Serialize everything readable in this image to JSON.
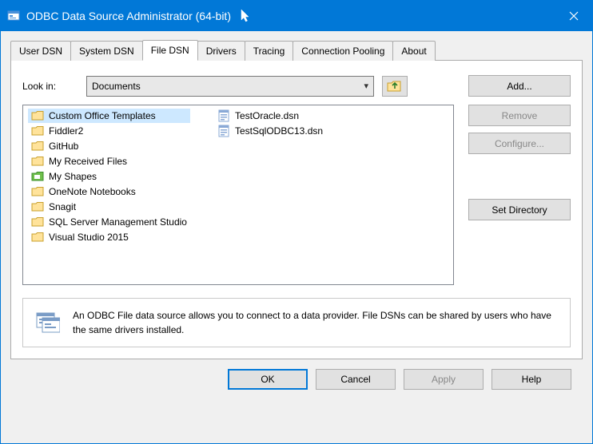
{
  "titlebar": {
    "title": "ODBC Data Source Administrator (64-bit)"
  },
  "tabs": {
    "items": [
      "User DSN",
      "System DSN",
      "File DSN",
      "Drivers",
      "Tracing",
      "Connection Pooling",
      "About"
    ],
    "active_index": 2
  },
  "lookin": {
    "label": "Look in:",
    "value": "Documents"
  },
  "folders": [
    "Custom Office Templates",
    "Fiddler2",
    "GitHub",
    "My Received Files",
    "My Shapes",
    "OneNote Notebooks",
    "Snagit",
    "SQL Server Management Studio",
    "Visual Studio 2015"
  ],
  "files": [
    "TestOracle.dsn",
    "TestSqlODBC13.dsn"
  ],
  "selected_item": "Custom Office Templates",
  "buttons": {
    "add": "Add...",
    "remove": "Remove",
    "configure": "Configure...",
    "set_directory": "Set Directory"
  },
  "info_text": "An ODBC File data source allows you to connect to a data provider.  File DSNs can be shared by users who have the same drivers installed.",
  "footer": {
    "ok": "OK",
    "cancel": "Cancel",
    "apply": "Apply",
    "help": "Help"
  }
}
